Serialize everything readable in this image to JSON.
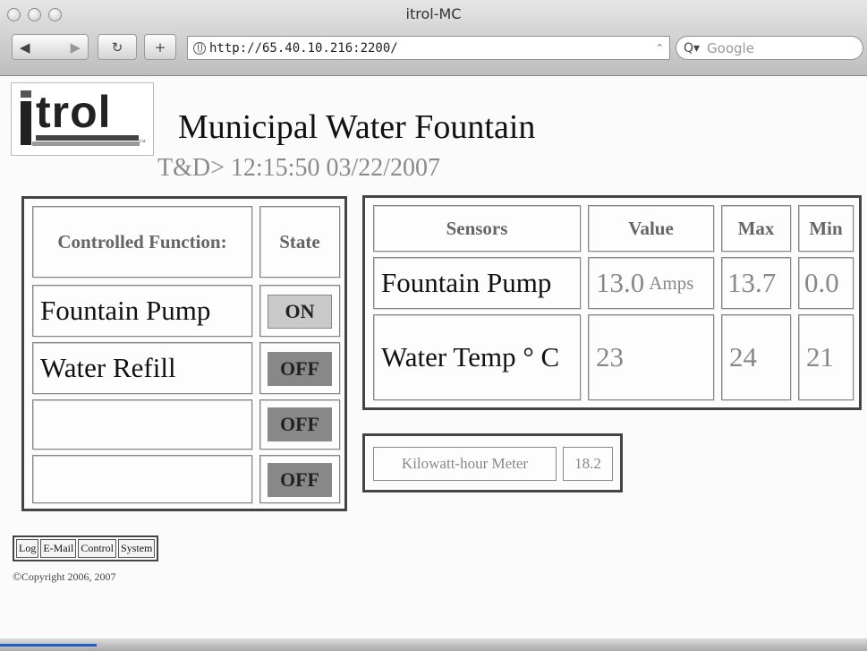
{
  "window": {
    "title": "itrol-MC"
  },
  "toolbar": {
    "back_glyph": "◀",
    "forward_glyph": "▶",
    "reload_glyph": "↻",
    "add_glyph": "+",
    "url": "http://65.40.10.216:2200/",
    "rss_glyph": "⌃",
    "search_placeholder": "Google",
    "search_icon_glyph": "Q▾"
  },
  "logo": {
    "text": "trol",
    "tm": "™"
  },
  "header": {
    "title": "Municipal Water Fountain",
    "datetime": "T&D> 12:15:50 03/22/2007"
  },
  "controls": {
    "col_function": "Controlled Function:",
    "col_state": "State",
    "rows": [
      {
        "function": "Fountain Pump",
        "state": "ON"
      },
      {
        "function": "Water Refill",
        "state": "OFF"
      },
      {
        "function": "",
        "state": "OFF"
      },
      {
        "function": "",
        "state": "OFF"
      }
    ]
  },
  "sensors": {
    "col_sensor": "Sensors",
    "col_value": "Value",
    "col_max": "Max",
    "col_min": "Min",
    "rows": [
      {
        "name": "Fountain Pump",
        "value": "13.0",
        "unit": "Amps",
        "max": "13.7",
        "min": "0.0"
      },
      {
        "name": "Water Temp ° C",
        "value": "23",
        "unit": "",
        "max": "24",
        "min": "21"
      }
    ]
  },
  "kwh": {
    "label": "Kilowatt-hour Meter",
    "value": "18.2"
  },
  "nav": [
    "Log",
    "E-Mail",
    "Control",
    "System"
  ],
  "footer": {
    "copyright_symbol": "©",
    "copyright": "Copyright 2006, 2007"
  },
  "colors": {
    "state_on": "#c9c9c9",
    "state_off": "#888888",
    "chrome": "#bdbdbd"
  }
}
